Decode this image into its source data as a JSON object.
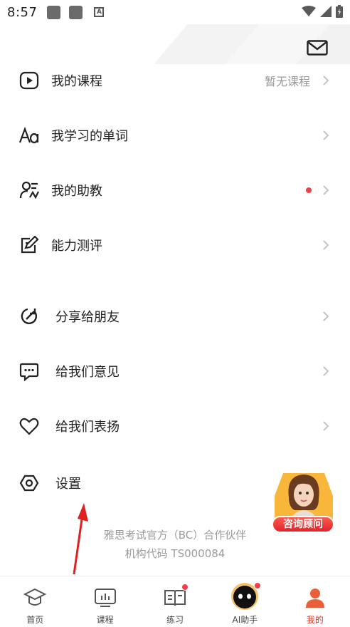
{
  "status": {
    "time": "8:57"
  },
  "menu_primary": [
    {
      "label": "我的课程",
      "hint": "暂无课程",
      "icon": "play-circle-icon"
    },
    {
      "label": "我学习的单词",
      "icon": "font-aa-icon"
    },
    {
      "label": "我的助教",
      "has_dot": true,
      "icon": "assistant-person-icon"
    },
    {
      "label": "能力测评",
      "icon": "edit-square-icon"
    }
  ],
  "menu_secondary": [
    {
      "label": "分享给朋友",
      "icon": "share-icon"
    },
    {
      "label": "给我们意见",
      "icon": "feedback-chat-icon"
    },
    {
      "label": "给我们表扬",
      "icon": "heart-icon"
    },
    {
      "label": "设置",
      "icon": "settings-hex-icon"
    }
  ],
  "advisor": {
    "label": "咨询顾问"
  },
  "footer": {
    "partner": "雅思考试官方（BC）合作伙伴",
    "institution_code": "机构代码 TS000084"
  },
  "bottom_nav": [
    {
      "label": "首页",
      "icon": "grad-cap-icon",
      "active": false,
      "badge": false
    },
    {
      "label": "课程",
      "icon": "course-screen-icon",
      "active": false,
      "badge": false
    },
    {
      "label": "练习",
      "icon": "book-icon",
      "active": false,
      "badge": true
    },
    {
      "label": "AI助手",
      "icon": "ai-robot-icon",
      "active": false,
      "badge": true
    },
    {
      "label": "我的",
      "icon": "profile-icon",
      "active": true,
      "badge": false
    }
  ],
  "colors": {
    "accent": "#e03a2a",
    "badge": "#f2404a",
    "muted": "#9a9a9a"
  }
}
